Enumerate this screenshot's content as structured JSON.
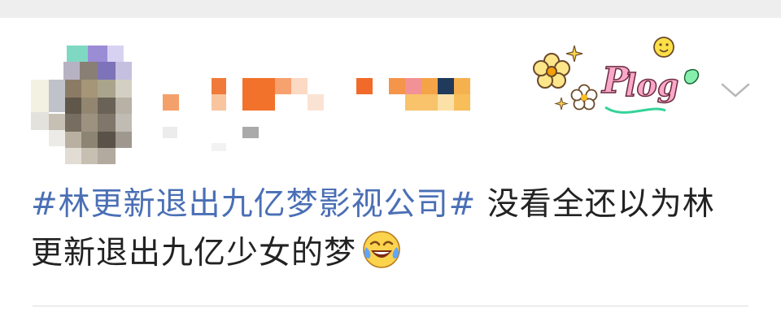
{
  "post": {
    "hashtag": "#林更新退出九亿梦影视公司#",
    "text": " 没看全还以为林更新退出九亿少女的梦",
    "emoji_icon": "laughing-crying-emoji-icon",
    "sticker_text": "Plog",
    "sticker_icon": "plog-sticker-icon",
    "menu_icon": "chevron-down-icon"
  },
  "colors": {
    "hashtag": "#4a6fb5",
    "text": "#222222",
    "background": "#ffffff",
    "page_bg": "#eeeeee",
    "divider": "#dcdcdc"
  }
}
